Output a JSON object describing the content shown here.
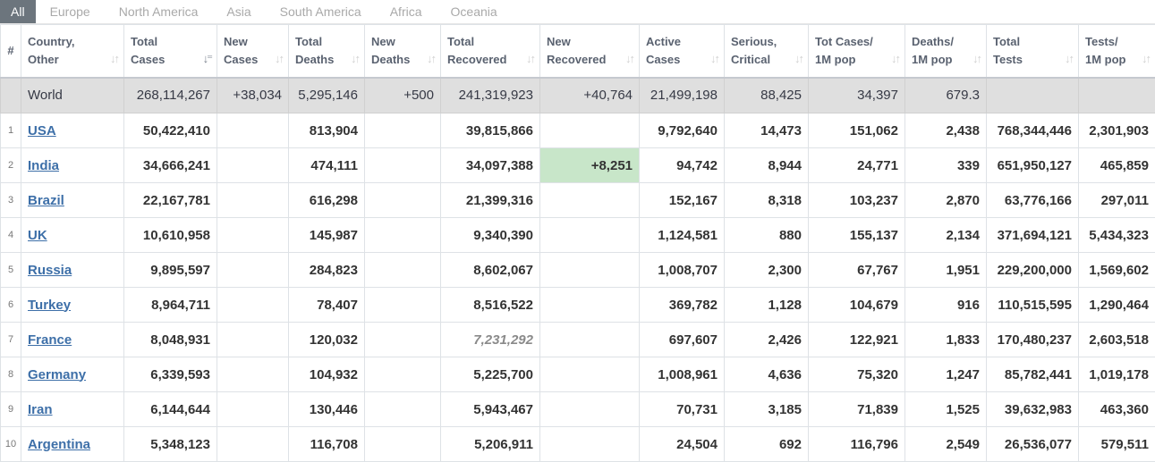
{
  "tabs": [
    "All",
    "Europe",
    "North America",
    "Asia",
    "South America",
    "Africa",
    "Oceania"
  ],
  "headers": {
    "idx": "#",
    "c1": [
      "Country,",
      "Other"
    ],
    "c2": [
      "Total",
      "Cases"
    ],
    "c3": [
      "New",
      "Cases"
    ],
    "c4": [
      "Total",
      "Deaths"
    ],
    "c5": [
      "New",
      "Deaths"
    ],
    "c6": [
      "Total",
      "Recovered"
    ],
    "c7": [
      "New",
      "Recovered"
    ],
    "c8": [
      "Active",
      "Cases"
    ],
    "c9": [
      "Serious,",
      "Critical"
    ],
    "c10": [
      "Tot Cases/",
      "1M pop"
    ],
    "c11": [
      "Deaths/",
      "1M pop"
    ],
    "c12": [
      "Total",
      "Tests"
    ],
    "c13": [
      "Tests/",
      "1M pop"
    ]
  },
  "world": [
    "",
    "World",
    "268,114,267",
    "+38,034",
    "5,295,146",
    "+500",
    "241,319,923",
    "+40,764",
    "21,499,198",
    "88,425",
    "34,397",
    "679.3",
    "",
    ""
  ],
  "rows": [
    [
      "1",
      "USA",
      "50,422,410",
      "",
      "813,904",
      "",
      "39,815,866",
      "",
      "9,792,640",
      "14,473",
      "151,062",
      "2,438",
      "768,344,446",
      "2,301,903"
    ],
    [
      "2",
      "India",
      "34,666,241",
      "",
      "474,111",
      "",
      "34,097,388",
      "+8,251",
      "94,742",
      "8,944",
      "24,771",
      "339",
      "651,950,127",
      "465,859"
    ],
    [
      "3",
      "Brazil",
      "22,167,781",
      "",
      "616,298",
      "",
      "21,399,316",
      "",
      "152,167",
      "8,318",
      "103,237",
      "2,870",
      "63,776,166",
      "297,011"
    ],
    [
      "4",
      "UK",
      "10,610,958",
      "",
      "145,987",
      "",
      "9,340,390",
      "",
      "1,124,581",
      "880",
      "155,137",
      "2,134",
      "371,694,121",
      "5,434,323"
    ],
    [
      "5",
      "Russia",
      "9,895,597",
      "",
      "284,823",
      "",
      "8,602,067",
      "",
      "1,008,707",
      "2,300",
      "67,767",
      "1,951",
      "229,200,000",
      "1,569,602"
    ],
    [
      "6",
      "Turkey",
      "8,964,711",
      "",
      "78,407",
      "",
      "8,516,522",
      "",
      "369,782",
      "1,128",
      "104,679",
      "916",
      "110,515,595",
      "1,290,464"
    ],
    [
      "7",
      "France",
      "8,048,931",
      "",
      "120,032",
      "",
      "7,231,292",
      "",
      "697,607",
      "2,426",
      "122,921",
      "1,833",
      "170,480,237",
      "2,603,518"
    ],
    [
      "8",
      "Germany",
      "6,339,593",
      "",
      "104,932",
      "",
      "5,225,700",
      "",
      "1,008,961",
      "4,636",
      "75,320",
      "1,247",
      "85,782,441",
      "1,019,178"
    ],
    [
      "9",
      "Iran",
      "6,144,644",
      "",
      "130,446",
      "",
      "5,943,467",
      "",
      "70,731",
      "3,185",
      "71,839",
      "1,525",
      "39,632,983",
      "463,360"
    ],
    [
      "10",
      "Argentina",
      "5,348,123",
      "",
      "116,708",
      "",
      "5,206,911",
      "",
      "24,504",
      "692",
      "116,796",
      "2,549",
      "26,536,077",
      "579,511"
    ]
  ],
  "icons": {
    "sort": "sort-arrows-icon",
    "sort_active": "sort-desc-icon"
  },
  "colors": {
    "link": "#3d6fa8",
    "world_bg": "#dfdfdf",
    "new_recovered_bg": "#c8e6c9",
    "active_tab": "#6c757d"
  }
}
